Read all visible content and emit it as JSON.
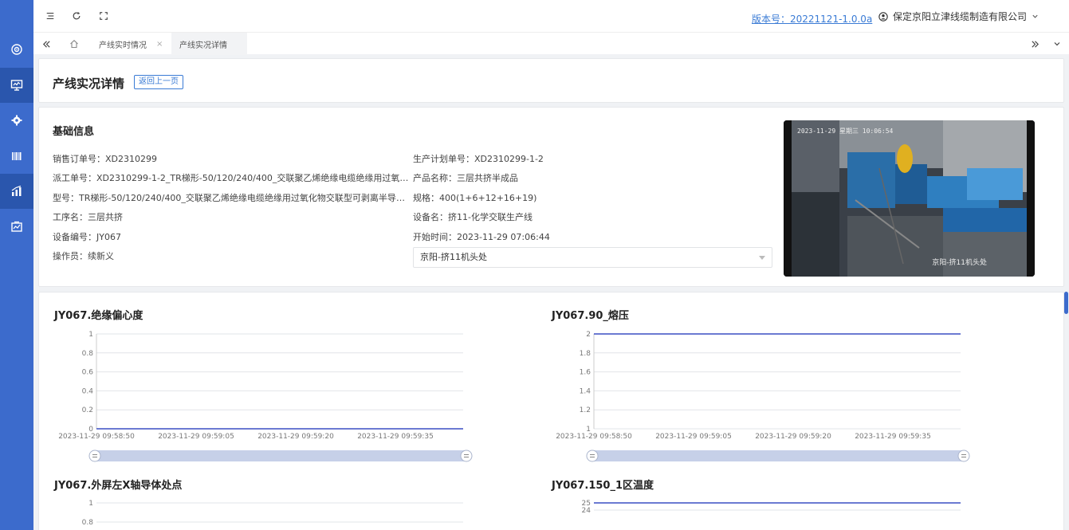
{
  "sidebar": {
    "items": [
      {
        "icon": "dashboard-icon"
      },
      {
        "icon": "monitor-icon"
      },
      {
        "icon": "gear-icon"
      },
      {
        "icon": "barcode-icon"
      },
      {
        "icon": "bar-chart-icon"
      },
      {
        "icon": "report-icon"
      }
    ]
  },
  "header": {
    "version_label": "版本号：20221121-1.0.0a",
    "company": "保定京阳立津线缆制造有限公司"
  },
  "tabs": [
    {
      "label": "产线实时情况"
    },
    {
      "label": "产线实况详情"
    }
  ],
  "page": {
    "title": "产线实况详情",
    "back_label": "返回上一页"
  },
  "basic_info": {
    "title": "基础信息",
    "sales_order": "销售订单号：XD2310299",
    "plan_order": "生产计划单号：XD2310299-1-2",
    "dispatch_order": "派工单号：XD2310299-1-2_TR梯形-50/120/240/400_交联聚乙烯绝缘电缆绝缘用过氧化物交联型可剥离半导电屏蔽料",
    "product_name": "产品名称：三层共挤半成品",
    "model": "型号：TR梯形-50/120/240/400_交联聚乙烯绝缘电缆绝缘用过氧化物交联型可剥离半导电屏蔽料",
    "spec": "规格：400(1+6+12+16+19)",
    "process": "工序名：三层共挤",
    "device_name": "设备名：挤11-化学交联生产线",
    "device_code": "设备编号：JY067",
    "start_time": "开始时间：2023-11-29 07:06:44",
    "operator": "操作员：续新义",
    "camera_select": "京阳-挤11机头处",
    "camera_timestamp": "2023-11-29 星期三 10:06:54",
    "camera_label": "京阳-挤11机头处"
  },
  "chart_data": [
    {
      "type": "line",
      "title": "JY067.绝缘偏心度",
      "x": [
        "2023-11-29 09:58:50",
        "2023-11-29 09:59:05",
        "2023-11-29 09:59:20",
        "2023-11-29 09:59:35"
      ],
      "yticks": [
        "0",
        "0.2",
        "0.4",
        "0.6",
        "0.8",
        "1"
      ],
      "ylim": [
        0,
        1
      ],
      "series": [
        {
          "values": [
            0,
            0,
            0,
            0
          ]
        }
      ],
      "line_color": "#3a4fc4"
    },
    {
      "type": "line",
      "title": "JY067.90_熔压",
      "x": [
        "2023-11-29 09:58:50",
        "2023-11-29 09:59:05",
        "2023-11-29 09:59:20",
        "2023-11-29 09:59:35"
      ],
      "yticks": [
        "1",
        "1.2",
        "1.4",
        "1.6",
        "1.8",
        "2"
      ],
      "ylim": [
        1,
        2
      ],
      "series": [
        {
          "values": [
            2,
            2,
            2,
            2
          ]
        }
      ],
      "line_color": "#3a4fc4"
    },
    {
      "type": "line",
      "title": "JY067.外屏左X轴导体处点",
      "yticks": [
        "0.8",
        "1"
      ],
      "ylim": [
        0,
        1
      ],
      "series": [
        {
          "values": []
        }
      ]
    },
    {
      "type": "line",
      "title": "JY067.150_1区温度",
      "yticks": [
        "24",
        "25"
      ],
      "ylim": [
        0,
        25
      ],
      "series": [
        {
          "values": [
            25,
            25,
            25,
            25
          ]
        }
      ],
      "line_color": "#3a4fc4"
    }
  ]
}
